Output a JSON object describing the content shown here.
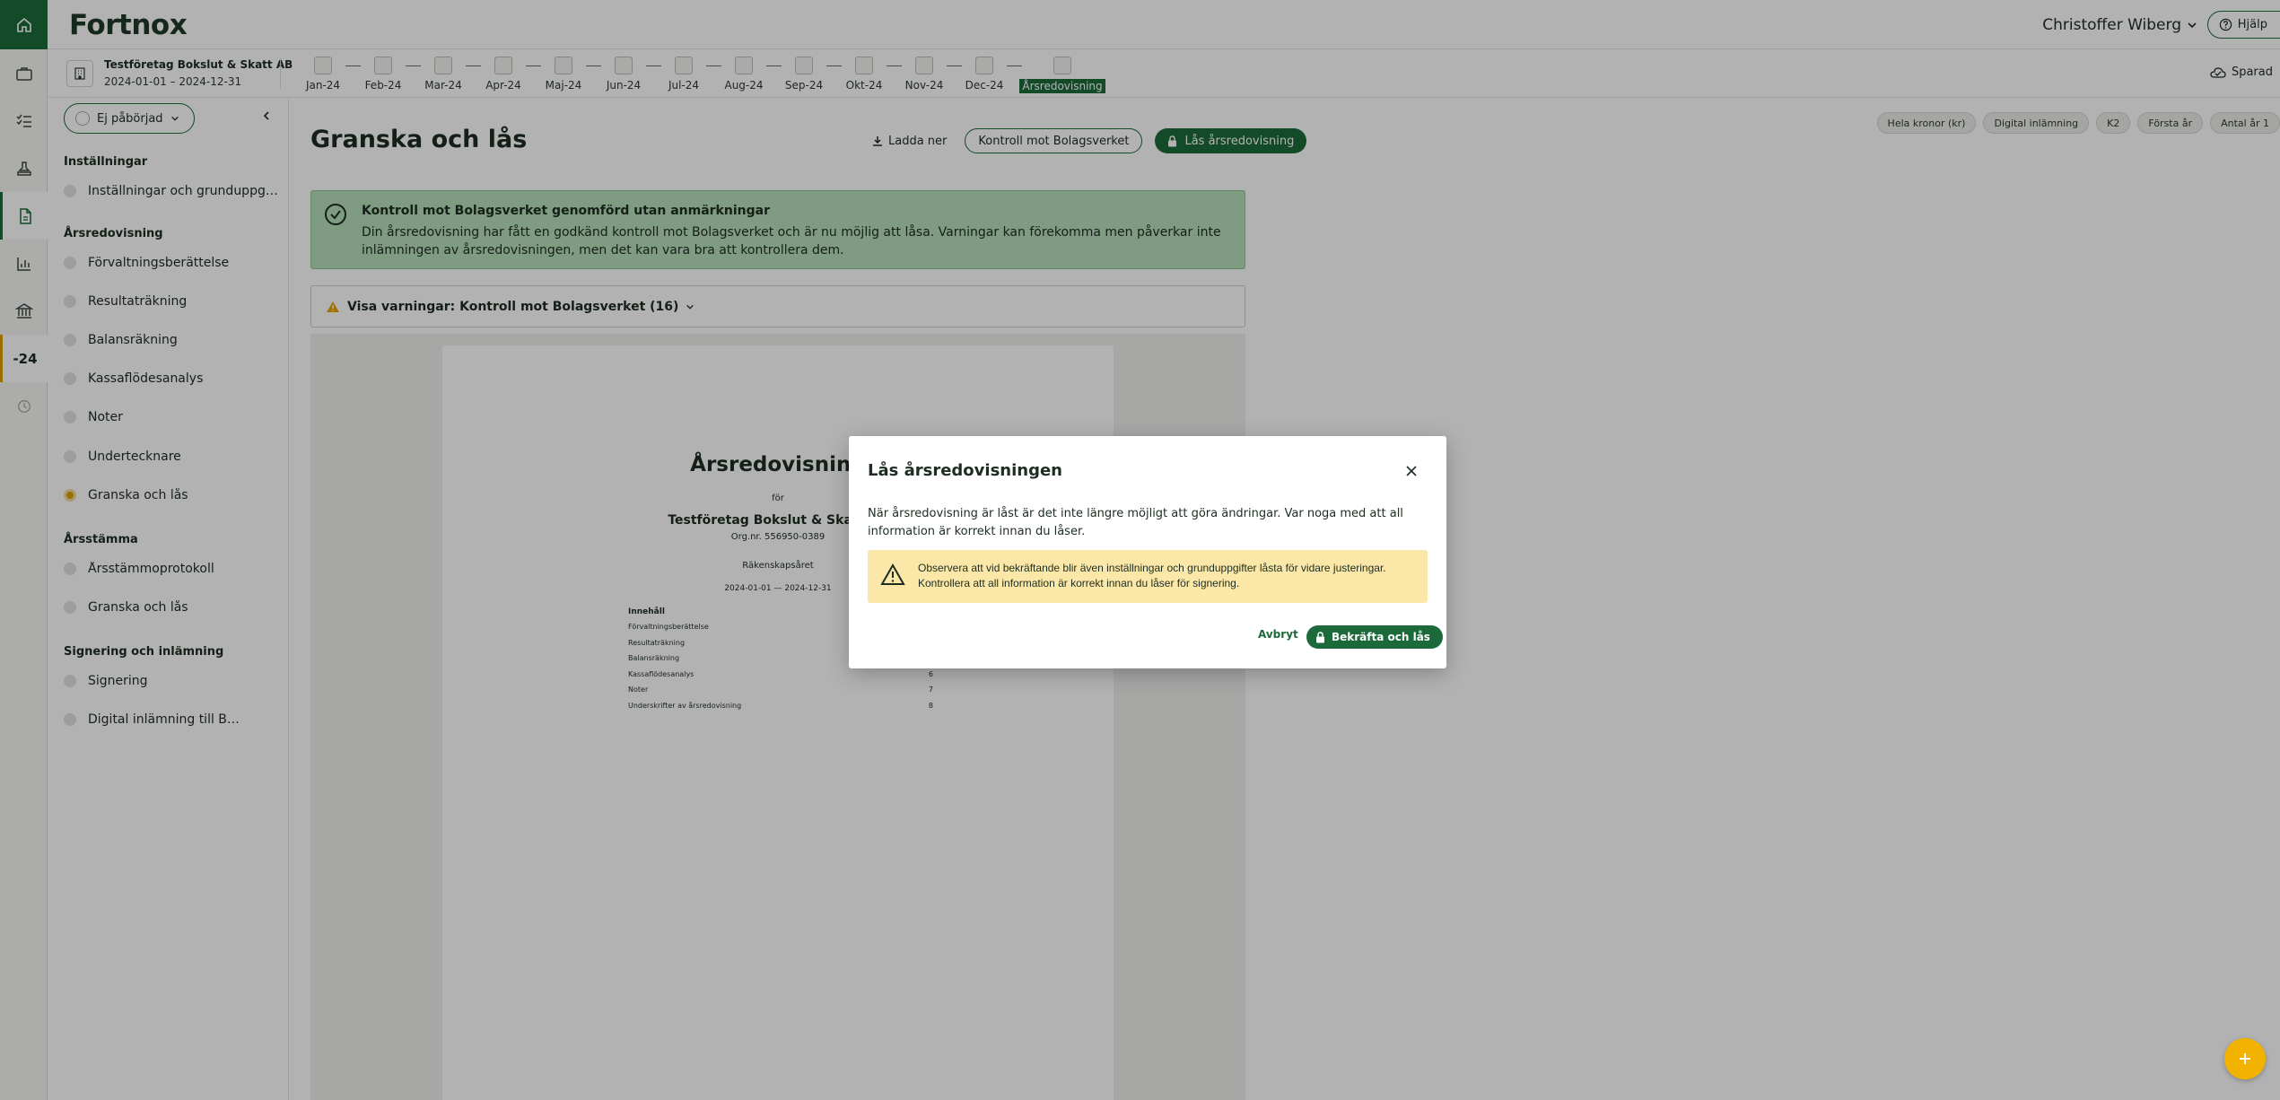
{
  "app": {
    "logo": "Fortnox"
  },
  "header": {
    "user_name": "Christoffer Wiberg",
    "help_label": "Hjälp",
    "saved_label": "Sparad"
  },
  "company": {
    "name": "Testföretag Bokslut & Skatt AB",
    "period": "2024-01-01 – 2024-12-31"
  },
  "months": [
    {
      "label": "Jan-24"
    },
    {
      "label": "Feb-24"
    },
    {
      "label": "Mar-24"
    },
    {
      "label": "Apr-24"
    },
    {
      "label": "Maj-24"
    },
    {
      "label": "Jun-24"
    },
    {
      "label": "Jul-24"
    },
    {
      "label": "Aug-24"
    },
    {
      "label": "Sep-24"
    },
    {
      "label": "Okt-24"
    },
    {
      "label": "Nov-24"
    },
    {
      "label": "Dec-24"
    },
    {
      "label": "Årsredovisning"
    }
  ],
  "rail": {
    "year_label": "-24"
  },
  "sidebar": {
    "status": "Ej påbörjad",
    "sections": {
      "settings": "Inställningar",
      "annual_report": "Årsredovisning",
      "agm": "Årsstämma",
      "signing": "Signering och inlämning"
    },
    "items": {
      "settings_basic": "Inställningar och grunduppgifter",
      "management_report": "Förvaltningsberättelse",
      "income_statement": "Resultaträkning",
      "balance_sheet": "Balansräkning",
      "cash_flow": "Kassaflödesanalys",
      "notes": "Noter",
      "signatories": "Undertecknare",
      "review_lock": "Granska och lås",
      "agm_protocol": "Årsstämmoprotokoll",
      "agm_review_lock": "Granska och lås",
      "signing": "Signering",
      "digital_submission": "Digital inlämning till Bolagsverket"
    }
  },
  "main": {
    "title": "Granska och lås",
    "download_label": "Ladda ner",
    "check_label": "Kontroll mot Bolagsverket",
    "lock_label": "Lås årsredovisning",
    "tags": [
      "Hela kronor (kr)",
      "Digital inlämning",
      "K2",
      "Första år",
      "Antal år 1"
    ],
    "success": {
      "heading": "Kontroll mot Bolagsverket genomförd utan anmärkningar",
      "body": "Din årsredovisning har fått en godkänd kontroll mot Bolagsverket och är nu möjlig att låsa. Varningar kan förekomma men påverkar inte inlämningen av årsredovisningen, men det kan vara bra att kontrollera dem."
    },
    "warnings_label": "Visa varningar: Kontroll mot Bolagsverket (16)"
  },
  "document": {
    "title": "Årsredovisning",
    "for_label": "för",
    "company": "Testföretag Bokslut & Skatt AB",
    "org": "Org.nr. 556950-0389",
    "fiscal_year_label": "Räkenskapsåret",
    "period": "2024-01-01 — 2024-12-31",
    "toc_heading": "Innehåll",
    "toc": [
      {
        "label": "Förvaltningsberättelse",
        "page": ""
      },
      {
        "label": "Resultaträkning",
        "page": ""
      },
      {
        "label": "Balansräkning",
        "page": ""
      },
      {
        "label": "Kassaflödesanalys",
        "page": "6"
      },
      {
        "label": "Noter",
        "page": "7"
      },
      {
        "label": "Underskrifter av årsredovisning",
        "page": "8"
      }
    ]
  },
  "modal": {
    "title": "Lås årsredovisningen",
    "text": "När årsredovisning är låst är det inte längre möjligt att göra ändringar. Var noga med att all information är korrekt innan du låser.",
    "warning": "Observera att vid bekräftande blir även inställningar och grunduppgifter låsta för vidare justeringar. Kontrollera att all information är korrekt innan du låser för signering.",
    "cancel_label": "Avbryt",
    "confirm_label": "Bekräfta och lås"
  },
  "colors": {
    "brand_green": "#1c6a3a",
    "success_bg": "#b6dfb9",
    "warning_bg": "#fbe7a7",
    "current_step": "#e0a100",
    "fab": "#f2b300"
  }
}
